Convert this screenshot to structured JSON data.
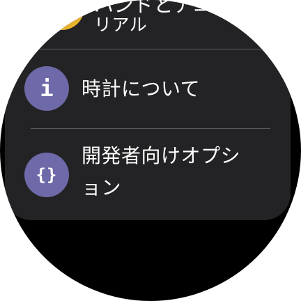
{
  "settings_list": {
    "tutorial": {
      "label_line1": "ハンドとアユ",
      "label_line2": "リアル",
      "icon": "tutorial-icon",
      "icon_color": "#e8b32c"
    },
    "about": {
      "label": "時計について",
      "icon": "info-icon",
      "icon_glyph": "i",
      "icon_color": "#6e69a8"
    },
    "developer_options": {
      "label_line1": "開発者向けオプシ",
      "label_line2": "ョン",
      "icon": "code-braces-icon",
      "icon_glyph": "{}",
      "icon_color": "#6e69a8"
    }
  },
  "colors": {
    "card_background": "#232325",
    "screen_background": "#000000",
    "divider": "#5a5a5e",
    "text": "#ffffff"
  }
}
